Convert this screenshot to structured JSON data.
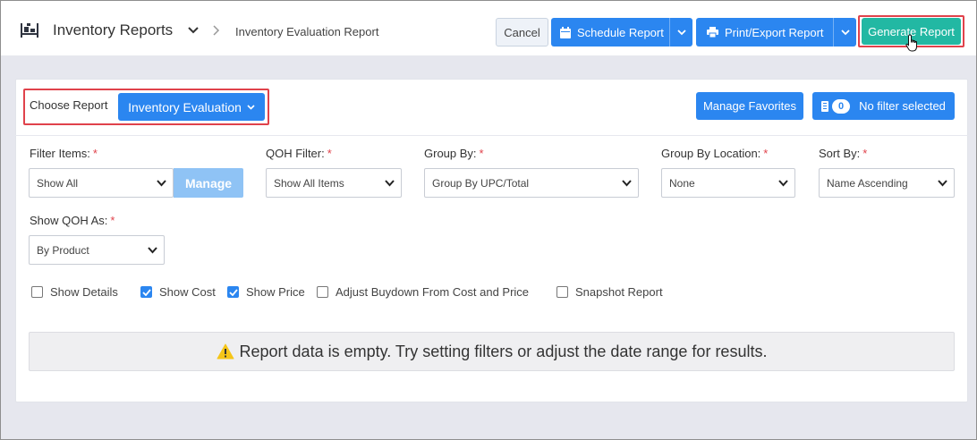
{
  "header": {
    "title": "Inventory Reports",
    "breadcrumb_current": "Inventory Evaluation Report",
    "cancel_label": "Cancel",
    "schedule_label": "Schedule Report",
    "print_label": "Print/Export Report",
    "generate_label": "Generate Report"
  },
  "report": {
    "choose_label": "Choose Report",
    "selected": "Inventory Evaluation",
    "favorites_label": "Manage Favorites",
    "filter_count": "0",
    "filter_label": "No filter selected"
  },
  "filters": {
    "filter_items": {
      "label": "Filter Items:",
      "value": "Show All",
      "manage_label": "Manage"
    },
    "qoh_filter": {
      "label": "QOH Filter:",
      "value": "Show All Items"
    },
    "group_by": {
      "label": "Group By:",
      "value": "Group By UPC/Total"
    },
    "group_by_location": {
      "label": "Group By Location:",
      "value": "None"
    },
    "sort_by": {
      "label": "Sort By:",
      "value": "Name Ascending"
    },
    "show_qoh_as": {
      "label": "Show QOH As:",
      "value": "By Product"
    },
    "required_mark": "*"
  },
  "options": [
    {
      "label": "Show Details",
      "checked": false
    },
    {
      "label": "Show Cost",
      "checked": true
    },
    {
      "label": "Show Price",
      "checked": true
    },
    {
      "label": "Adjust Buydown From Cost and Price",
      "checked": false
    },
    {
      "label": "Snapshot Report",
      "checked": false
    }
  ],
  "alert": {
    "message": "Report data is empty. Try setting filters or adjust the date range for results."
  },
  "colors": {
    "primary": "#2b86f0",
    "generate": "#22b8a3",
    "highlight": "#e0424b",
    "warning": "#f5c518"
  },
  "icons": {
    "app": "inventory-icon",
    "schedule": "calendar-icon",
    "print": "printer-icon",
    "filter": "filter-icon",
    "alert": "warning-icon"
  }
}
